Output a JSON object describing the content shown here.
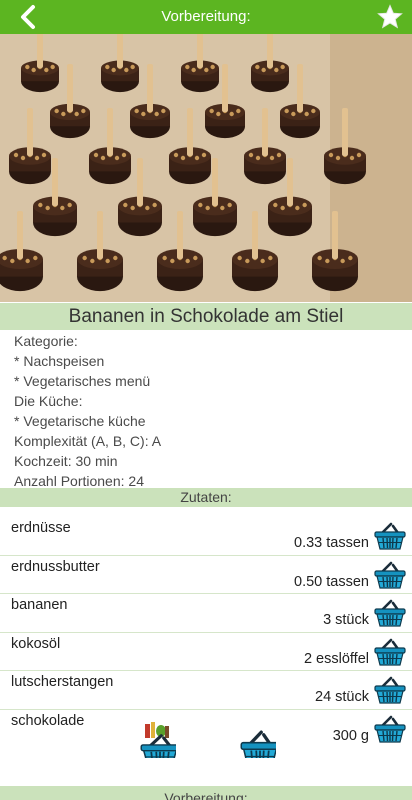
{
  "topbar": {
    "title": "Vorbereitung:"
  },
  "recipe": {
    "title": "Bananen in Schokolade am Stiel"
  },
  "info": [
    "Kategorie:",
    "* Nachspeisen",
    "* Vegetarisches menü",
    "Die Küche:",
    "* Vegetarische küche",
    "Komplexität (A, B, C): A",
    "Kochzeit: 30 min",
    "Anzahl Portionen: 24"
  ],
  "ingredients_header": "Zutaten:",
  "ingredients": [
    {
      "name": "erdnüsse",
      "qty": "0.33 tassen"
    },
    {
      "name": "erdnussbutter",
      "qty": "0.50 tassen"
    },
    {
      "name": "bananen",
      "qty": "3 stück"
    },
    {
      "name": "kokosöl",
      "qty": "2 esslöffel"
    },
    {
      "name": "lutscherstangen",
      "qty": "24 stück"
    },
    {
      "name": "schokolade",
      "qty": "300 g"
    }
  ],
  "footer_header": "Vorbereitung:",
  "icons": {
    "back": "chevron-left-icon",
    "favorite": "star-icon",
    "basket": "basket-icon",
    "grocery": "grocery-basket-icon"
  },
  "colors": {
    "header": "#5cb521",
    "section": "#cbe2bb",
    "basket": "#1aa3c8"
  }
}
